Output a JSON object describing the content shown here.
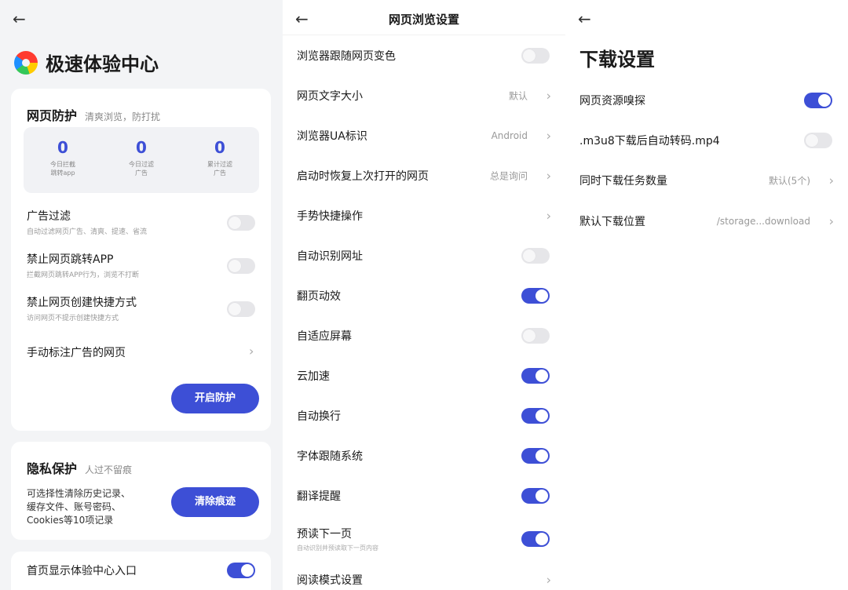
{
  "panel1": {
    "title": "极速体验中心",
    "protection": {
      "heading": "网页防护",
      "subtitle": "清爽浏览，防打扰",
      "stats": [
        {
          "value": "0",
          "label": "今日拦截\n跳转app"
        },
        {
          "value": "0",
          "label": "今日过滤\n广告"
        },
        {
          "value": "0",
          "label": "累计过滤\n广告"
        }
      ],
      "options": [
        {
          "title": "广告过滤",
          "desc": "自动过滤网页广告、清爽、提速、省流",
          "on": false
        },
        {
          "title": "禁止网页跳转APP",
          "desc": "拦截网页跳转APP行为，浏览不打断",
          "on": false
        },
        {
          "title": "禁止网页创建快捷方式",
          "desc": "访问网页不提示创建快捷方式",
          "on": false
        }
      ],
      "manual_mark": "手动标注广告的网页",
      "enable_button": "开启防护"
    },
    "privacy": {
      "heading": "隐私保护",
      "subtitle": "人过不留痕",
      "desc": "可选择性清除历史记录、\n缓存文件、账号密码、\nCookies等10项记录",
      "clear_button": "清除痕迹"
    },
    "home_entry": {
      "label": "首页显示体验中心入口",
      "on": true
    }
  },
  "panel2": {
    "title": "网页浏览设置",
    "rows": [
      {
        "label": "浏览器跟随网页变色",
        "type": "toggle",
        "on": false
      },
      {
        "label": "网页文字大小",
        "type": "value",
        "value": "默认"
      },
      {
        "label": "浏览器UA标识",
        "type": "value",
        "value": "Android"
      },
      {
        "label": "启动时恢复上次打开的网页",
        "type": "value",
        "value": "总是询问"
      },
      {
        "label": "手势快捷操作",
        "type": "chevron"
      },
      {
        "label": "自动识别网址",
        "type": "toggle",
        "on": false
      },
      {
        "label": "翻页动效",
        "type": "toggle",
        "on": true
      },
      {
        "label": "自适应屏幕",
        "type": "toggle",
        "on": false
      },
      {
        "label": "云加速",
        "type": "toggle",
        "on": true
      },
      {
        "label": "自动换行",
        "type": "toggle",
        "on": true
      },
      {
        "label": "字体跟随系统",
        "type": "toggle",
        "on": true
      },
      {
        "label": "翻译提醒",
        "type": "toggle",
        "on": true
      },
      {
        "label": "预读下一页",
        "sub": "自动识别并预读取下一页内容",
        "type": "toggle",
        "on": true
      },
      {
        "label": "阅读模式设置",
        "type": "chevron"
      }
    ]
  },
  "panel3": {
    "title": "下载设置",
    "rows": [
      {
        "label": "网页资源嗅探",
        "type": "toggle",
        "on": true
      },
      {
        "label": ".m3u8下载后自动转码.mp4",
        "type": "toggle",
        "on": false
      },
      {
        "label": "同时下载任务数量",
        "type": "value",
        "value": "默认(5个)"
      },
      {
        "label": "默认下载位置",
        "type": "value",
        "value": "/storage...download"
      }
    ]
  },
  "icons": {
    "back": "←",
    "chevron": "›"
  },
  "colors": {
    "accent": "#3d4fd6",
    "panel_bg": "#f3f4f6"
  }
}
